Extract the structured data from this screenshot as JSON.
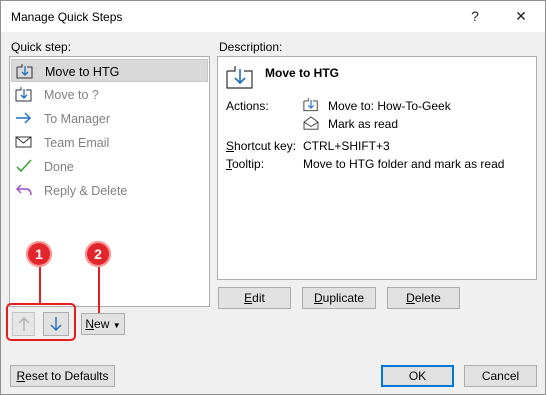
{
  "window": {
    "title": "Manage Quick Steps",
    "help_glyph": "?",
    "close_glyph": "✕"
  },
  "quick_step_label": "Quick step:",
  "description_label": "Description:",
  "steps": [
    {
      "label": "Move to HTG",
      "icon": "move-to-folder-icon",
      "selected": true
    },
    {
      "label": "Move to ?",
      "icon": "move-to-folder-icon",
      "selected": false
    },
    {
      "label": "To Manager",
      "icon": "forward-arrow-icon",
      "selected": false
    },
    {
      "label": "Team Email",
      "icon": "envelope-icon",
      "selected": false
    },
    {
      "label": "Done",
      "icon": "checkmark-icon",
      "selected": false
    },
    {
      "label": "Reply & Delete",
      "icon": "reply-icon",
      "selected": false
    }
  ],
  "description": {
    "name": "Move to HTG",
    "actions_label": "Actions:",
    "actions": [
      {
        "text": "Move to: How-To-Geek",
        "icon": "move-to-folder-icon"
      },
      {
        "text": "Mark as read",
        "icon": "open-envelope-icon"
      }
    ],
    "shortcut_label": "Shortcut key:",
    "shortcut_value": "CTRL+SHIFT+3",
    "tooltip_label": "Tooltip:",
    "tooltip_value": "Move to HTG folder and mark as read"
  },
  "buttons": {
    "edit": "Edit",
    "duplicate": "Duplicate",
    "delete": "Delete",
    "new": "New",
    "reset": "Reset to Defaults",
    "ok": "OK",
    "cancel": "Cancel"
  },
  "callouts": {
    "one": "1",
    "two": "2"
  },
  "colors": {
    "accent": "#0078d7",
    "callout": "#e3262b"
  }
}
